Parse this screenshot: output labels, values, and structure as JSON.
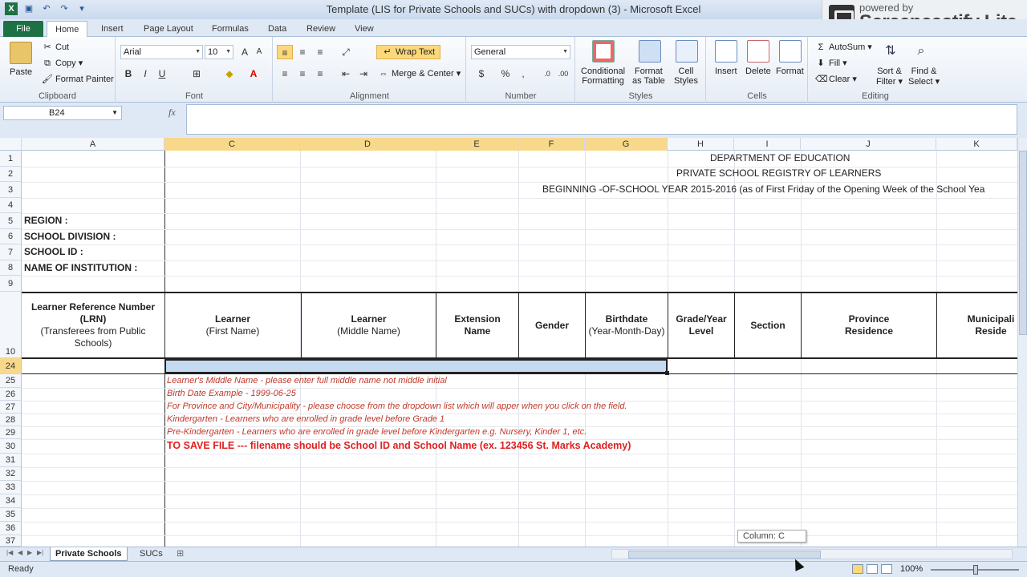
{
  "window": {
    "title": "Template (LIS for Private Schools and SUCs) with dropdown (3)  -  Microsoft Excel"
  },
  "overlay": {
    "powered_by": "powered by",
    "brand": "Screencastify Lite"
  },
  "tabs": [
    "File",
    "Home",
    "Insert",
    "Page Layout",
    "Formulas",
    "Data",
    "Review",
    "View"
  ],
  "ribbon": {
    "clipboard": {
      "paste": "Paste",
      "cut": "Cut",
      "copy": "Copy",
      "format_painter": "Format Painter",
      "label": "Clipboard"
    },
    "font": {
      "name": "Arial",
      "size": "10",
      "label": "Font"
    },
    "alignment": {
      "wrap_text": "Wrap Text",
      "merge_center": "Merge & Center",
      "label": "Alignment"
    },
    "number": {
      "format": "General",
      "label": "Number"
    },
    "styles": {
      "conditional": "Conditional",
      "formatting": "Formatting",
      "format": "Format",
      "as_table": "as Table",
      "cell": "Cell",
      "cell_styles": "Styles",
      "label": "Styles"
    },
    "cells": {
      "insert": "Insert",
      "delete": "Delete",
      "format": "Format",
      "label": "Cells"
    },
    "editing": {
      "autosum": "AutoSum",
      "fill": "Fill",
      "clear": "Clear",
      "sort": "Sort &",
      "filter": "Filter",
      "find": "Find &",
      "select": "Select",
      "label": "Editing"
    }
  },
  "formula_bar": {
    "name_box": "B24",
    "fx": "fx",
    "value": ""
  },
  "columns": [
    "A",
    "C",
    "D",
    "E",
    "F",
    "G",
    "H",
    "I",
    "J",
    "K"
  ],
  "rows": [
    "1",
    "2",
    "3",
    "4",
    "5",
    "6",
    "7",
    "8",
    "9",
    "10",
    "24",
    "25",
    "26",
    "27",
    "28",
    "29",
    "30",
    "31",
    "32",
    "33",
    "34",
    "35",
    "36",
    "37"
  ],
  "sheet": {
    "heading1": "DEPARTMENT OF EDUCATION",
    "heading2": "PRIVATE SCHOOL REGISTRY OF LEARNERS",
    "heading3": "BEGINNING -OF-SCHOOL YEAR 2015-2016 (as of First Friday of the Opening Week of the School Yea",
    "region": "REGION :",
    "division": "SCHOOL DIVISION :",
    "school_id": "SCHOOL ID :",
    "institution": "NAME OF INSTITUTION :",
    "headers": {
      "lrn_title": "Learner Reference Number (LRN)",
      "lrn_sub": "(Transferees from Public Schools)",
      "learner": "Learner",
      "first_name": "(First Name)",
      "middle_name": "(Middle Name)",
      "extension": "Extension Name",
      "gender": "Gender",
      "birthdate": "Birthdate",
      "birthdate_sub": "(Year-Month-Day)",
      "grade": "Grade/Year Level",
      "section": "Section",
      "province": "Province Residence",
      "municipality": "Municipali Reside"
    },
    "notes": [
      "Learner's Middle Name - please enter full middle name not middle initial",
      "Birth Date Example -  1999-06-25",
      "For Province and City/Municipality - please choose from the dropdown list which will apper when you click on the field.",
      "Kindergarten - Learners who are enrolled in grade level before Grade 1",
      "Pre-Kindergarten - Learners who are enrolled in grade level before Kindergarten e.g. Nursery, Kinder 1, etc."
    ],
    "save_note": "TO SAVE FILE --- filename should be School ID and School Name  (ex. 123456 St. Marks Academy)"
  },
  "tooltip": "Column: C",
  "sheet_tabs": [
    "Private Schools",
    "SUCs"
  ],
  "status": {
    "ready": "Ready",
    "zoom": "100%"
  }
}
